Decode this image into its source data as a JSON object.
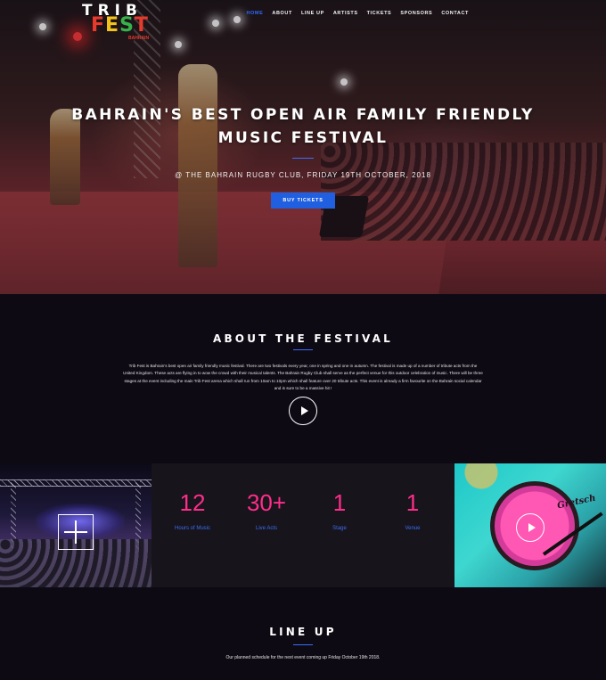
{
  "brand": {
    "logo_line1": "TRIB",
    "logo_line2_letters": [
      "F",
      "E",
      "S",
      "T"
    ],
    "logo_sub": "BAHRAIN"
  },
  "nav": {
    "items": [
      {
        "label": "HOME",
        "active": true
      },
      {
        "label": "ABOUT",
        "active": false
      },
      {
        "label": "LINE UP",
        "active": false
      },
      {
        "label": "ARTISTS",
        "active": false
      },
      {
        "label": "TICKETS",
        "active": false
      },
      {
        "label": "SPONSORS",
        "active": false
      },
      {
        "label": "CONTACT",
        "active": false
      }
    ]
  },
  "hero": {
    "title": "BAHRAIN'S BEST OPEN AIR FAMILY FRIENDLY MUSIC FESTIVAL",
    "subtitle": "@ THE BAHRAIN RUGBY CLUB, FRIDAY 19TH OCTOBER, 2018",
    "cta_label": "BUY TICKETS"
  },
  "about": {
    "title": "ABOUT THE FESTIVAL",
    "body": "Trib Fest is Bahrain's best open air family friendly music festival. There are two festivals every year, one in spring and one in autumn. The festival is made up of a number of tribute acts from the United Kingdom. These acts are flying in to wow the crowd with their musical talents. The Bahrain Rugby Club shall serve as the perfect venue for this outdoor celebration of music. There will be three stages at the event including the main Trib Fest arena which shall run from 10am to 10pm which shall feature over 20 tribute acts. This event is already a firm favourite on the Bahrain social calendar and is sure to be a massive hit !",
    "video_icon": "play-icon"
  },
  "stats": [
    {
      "value": "12",
      "label": "Hours of Music"
    },
    {
      "value": "30+",
      "label": "Live Acts"
    },
    {
      "value": "1",
      "label": "Stage"
    },
    {
      "value": "1",
      "label": "Venue"
    }
  ],
  "drum_brand": "Gretsch",
  "lineup": {
    "title": "LINE UP",
    "subtitle": "Our planned schedule for the next event coming up Friday October 19th 2018."
  },
  "colors": {
    "accent_blue": "#1f5fe0",
    "stat_pink": "#ff2d8a",
    "stat_label_blue": "#3d6ef2",
    "background": "#0e0a14"
  }
}
